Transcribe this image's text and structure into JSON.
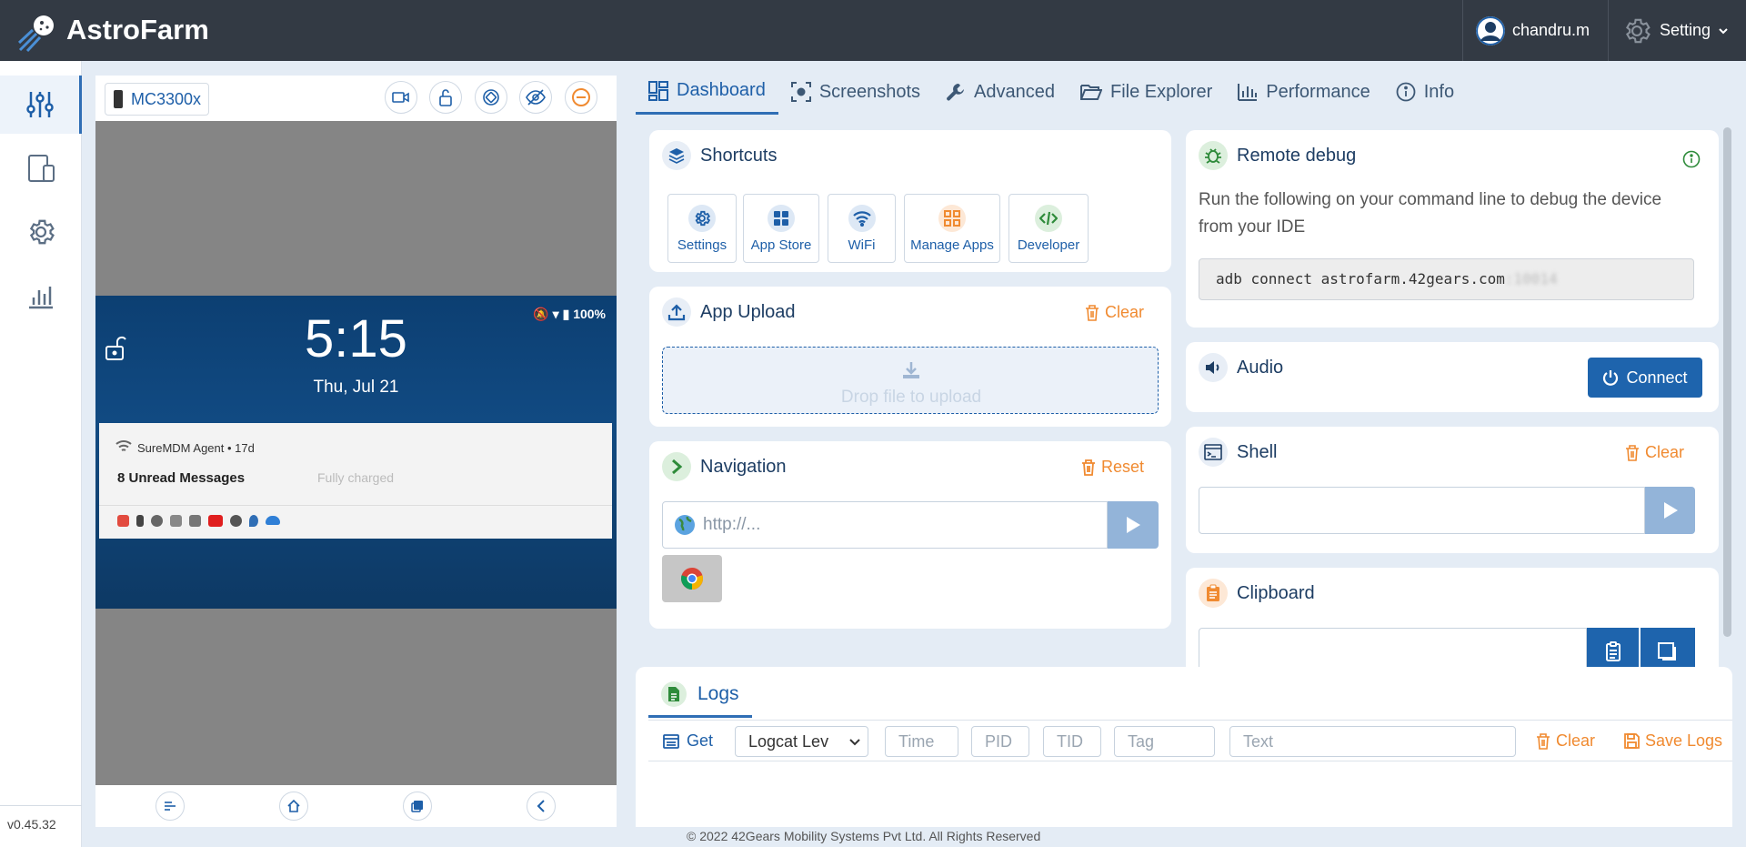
{
  "app": {
    "name": "AstroFarm",
    "version": "v0.45.32"
  },
  "header": {
    "user_name": "chandru.m",
    "setting_label": "Setting"
  },
  "sidebar": {
    "items": [
      {
        "icon": "sliders-icon",
        "active": true
      },
      {
        "icon": "devices-icon",
        "active": false
      },
      {
        "icon": "gear-icon",
        "active": false
      },
      {
        "icon": "bar-chart-icon",
        "active": false
      }
    ]
  },
  "device": {
    "name": "MC3300x",
    "lockscreen": {
      "time": "5:15",
      "date": "Thu, Jul 21",
      "battery": "100%",
      "notification_app": "SureMDM Agent • 17d",
      "notification_text": "8 Unread Messages",
      "notification_faint": "Fully charged"
    }
  },
  "tabs": [
    {
      "label": "Dashboard",
      "active": true
    },
    {
      "label": "Screenshots",
      "active": false
    },
    {
      "label": "Advanced",
      "active": false
    },
    {
      "label": "File Explorer",
      "active": false
    },
    {
      "label": "Performance",
      "active": false
    },
    {
      "label": "Info",
      "active": false
    }
  ],
  "shortcuts": {
    "title": "Shortcuts",
    "items": [
      {
        "label": "Settings",
        "color": "#1e5fa8"
      },
      {
        "label": "App Store",
        "color": "#1e5fa8"
      },
      {
        "label": "WiFi",
        "color": "#1e5fa8"
      },
      {
        "label": "Manage Apps",
        "color": "#f08a30"
      },
      {
        "label": "Developer",
        "color": "#2e8b3a"
      }
    ]
  },
  "app_upload": {
    "title": "App Upload",
    "clear_label": "Clear",
    "drop_text": "Drop file to upload"
  },
  "navigation": {
    "title": "Navigation",
    "reset_label": "Reset",
    "url_placeholder": "http://..."
  },
  "remote_debug": {
    "title": "Remote debug",
    "description": "Run the following on your command line to debug the device from your IDE",
    "command": "adb connect astrofarm.42gears.com"
  },
  "audio": {
    "title": "Audio",
    "connect_label": "Connect"
  },
  "shell": {
    "title": "Shell",
    "clear_label": "Clear"
  },
  "clipboard": {
    "title": "Clipboard"
  },
  "logs": {
    "title": "Logs",
    "get_label": "Get",
    "level_select": "Logcat Lev",
    "time_placeholder": "Time",
    "pid_placeholder": "PID",
    "tid_placeholder": "TID",
    "tag_placeholder": "Tag",
    "text_placeholder": "Text",
    "clear_label": "Clear",
    "save_label": "Save Logs"
  },
  "footer": {
    "copyright": "© 2022 42Gears Mobility Systems Pvt Ltd. All Rights Reserved"
  },
  "colors": {
    "accent": "#1e5fa8",
    "orange": "#f08a30",
    "header_bg": "#333a44",
    "page_bg": "#e4ecf5"
  }
}
